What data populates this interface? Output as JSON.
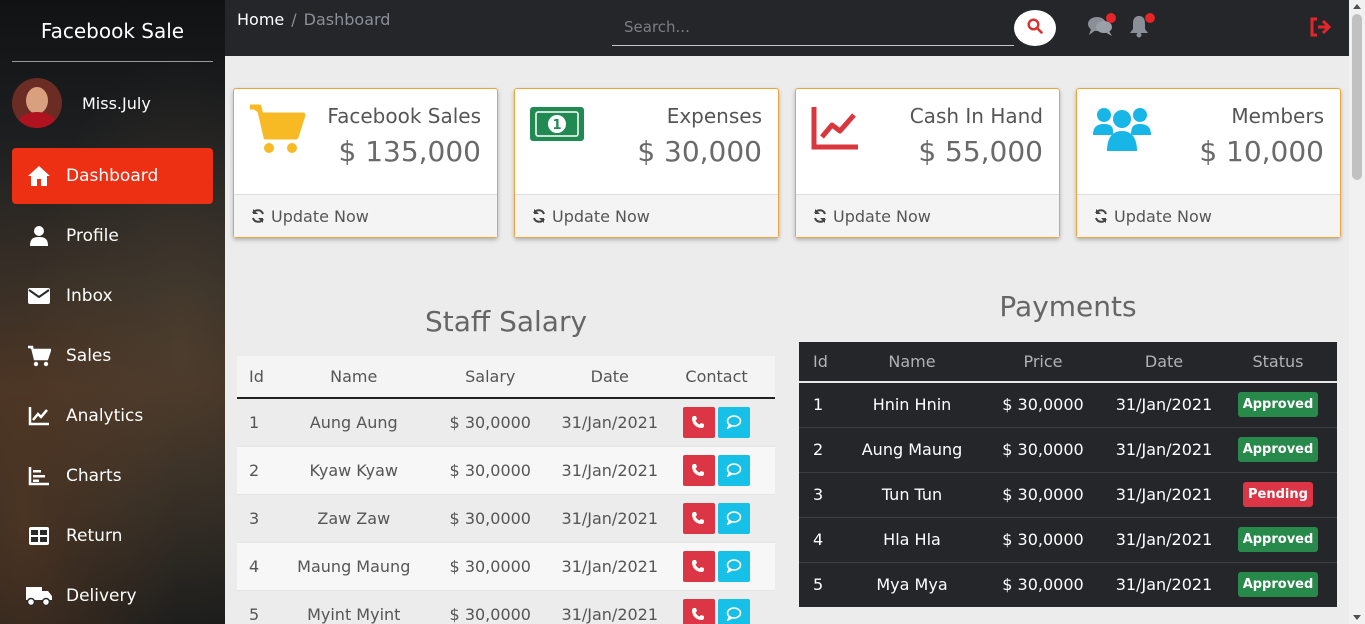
{
  "brand": "Facebook Sale",
  "user": {
    "name": "Miss.July"
  },
  "nav": [
    {
      "label": "Dashboard",
      "icon": "home-icon",
      "active": true
    },
    {
      "label": "Profile",
      "icon": "user-icon"
    },
    {
      "label": "Inbox",
      "icon": "envelope-icon"
    },
    {
      "label": "Sales",
      "icon": "cart-icon"
    },
    {
      "label": "Analytics",
      "icon": "line-chart-icon"
    },
    {
      "label": "Charts",
      "icon": "bar-chart-icon"
    },
    {
      "label": "Return",
      "icon": "table-icon"
    },
    {
      "label": "Delivery",
      "icon": "truck-icon"
    }
  ],
  "breadcrumb": {
    "home": "Home",
    "separator": "/",
    "current": "Dashboard"
  },
  "search": {
    "placeholder": "Search..."
  },
  "cards": [
    {
      "title": "Facebook Sales",
      "value": "$ 135,000",
      "footer": "Update Now",
      "icon": "cart-icon",
      "color": "#f7b924"
    },
    {
      "title": "Expenses",
      "value": "$ 30,000",
      "footer": "Update Now",
      "icon": "money-bill-icon",
      "color": "#218a52"
    },
    {
      "title": "Cash In Hand",
      "value": "$ 55,000",
      "footer": "Update Now",
      "icon": "line-chart-icon",
      "color": "#d9363e"
    },
    {
      "title": "Members",
      "value": "$ 10,000",
      "footer": "Update Now",
      "icon": "users-icon",
      "color": "#17b6e6"
    }
  ],
  "staff": {
    "title": "Staff Salary",
    "columns": [
      "Id",
      "Name",
      "Salary",
      "Date",
      "Contact"
    ],
    "rows": [
      {
        "id": "1",
        "name": "Aung Aung",
        "salary": "$ 30,0000",
        "date": "31/Jan/2021"
      },
      {
        "id": "2",
        "name": "Kyaw Kyaw",
        "salary": "$ 30,0000",
        "date": "31/Jan/2021"
      },
      {
        "id": "3",
        "name": "Zaw Zaw",
        "salary": "$ 30,0000",
        "date": "31/Jan/2021"
      },
      {
        "id": "4",
        "name": "Maung Maung",
        "salary": "$ 30,0000",
        "date": "31/Jan/2021"
      },
      {
        "id": "5",
        "name": "Myint Myint",
        "salary": "$ 30,0000",
        "date": "31/Jan/2021"
      }
    ]
  },
  "payments": {
    "title": "Payments",
    "columns": [
      "Id",
      "Name",
      "Price",
      "Date",
      "Status"
    ],
    "rows": [
      {
        "id": "1",
        "name": "Hnin Hnin",
        "price": "$ 30,0000",
        "date": "31/Jan/2021",
        "status": "Approved"
      },
      {
        "id": "2",
        "name": "Aung Maung",
        "price": "$ 30,0000",
        "date": "31/Jan/2021",
        "status": "Approved"
      },
      {
        "id": "3",
        "name": "Tun Tun",
        "price": "$ 30,0000",
        "date": "31/Jan/2021",
        "status": "Pending"
      },
      {
        "id": "4",
        "name": "Hla Hla",
        "price": "$ 30,0000",
        "date": "31/Jan/2021",
        "status": "Approved"
      },
      {
        "id": "5",
        "name": "Mya Mya",
        "price": "$ 30,0000",
        "date": "31/Jan/2021",
        "status": "Approved"
      }
    ]
  },
  "colors": {
    "accent": "#ed2f13",
    "topbar": "#24262a",
    "card_border": "#f2a23a"
  }
}
